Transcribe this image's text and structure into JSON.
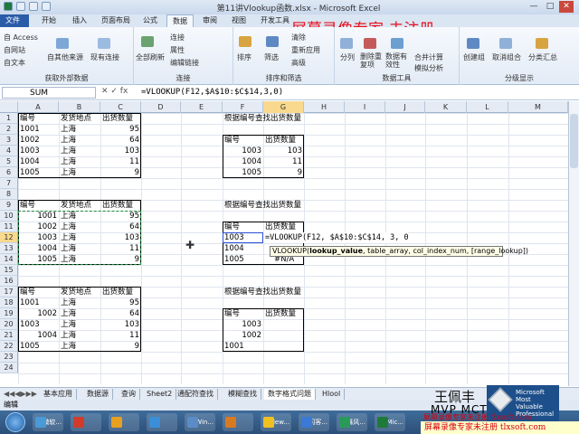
{
  "titlebar": {
    "title": "第11讲Vlookup函数.xlsx - Microsoft Excel",
    "min": "—",
    "max": "□",
    "close": "✕"
  },
  "tabs": [
    "文件",
    "开始",
    "插入",
    "页面布局",
    "公式",
    "数据",
    "审阅",
    "视图",
    "开发工具"
  ],
  "active_tab": "数据",
  "watermark_top": "屏幕录像专家 未注册",
  "ribbon": {
    "get_external": {
      "items": [
        "自 Access",
        "自网站",
        "自文本",
        "自其他来源",
        "现有连接"
      ],
      "label": "获取外部数据"
    },
    "connections": {
      "items": [
        "全部刷新",
        "连接",
        "属性",
        "编辑链接"
      ],
      "label": "连接"
    },
    "sort_filter": {
      "items": [
        "排序",
        "筛选",
        "清除",
        "重新应用",
        "高级"
      ],
      "label": "排序和筛选"
    },
    "data_tools": {
      "items": [
        "分列",
        "删除重复项",
        "数据有效性",
        "合并计算",
        "模拟分析"
      ],
      "label": "数据工具"
    },
    "outline": {
      "items": [
        "创建组",
        "取消组合",
        "分类汇总"
      ],
      "label": "分级显示"
    }
  },
  "formula_bar": {
    "name_box": "SUM",
    "fx": "✕ ✓ fx",
    "formula": "=VLOOKUP(F12,$A$10:$C$14,3,0)"
  },
  "columns": [
    "A",
    "B",
    "C",
    "D",
    "E",
    "F",
    "G",
    "H",
    "I",
    "J",
    "K",
    "L",
    "M"
  ],
  "rows": [
    "1",
    "2",
    "3",
    "4",
    "5",
    "6",
    "7",
    "8",
    "9",
    "10",
    "11",
    "12",
    "13",
    "14",
    "15",
    "16",
    "17",
    "18",
    "19",
    "20",
    "21",
    "22",
    "23",
    "24"
  ],
  "table1": {
    "headers": [
      "编号",
      "发货地点",
      "出货数量"
    ],
    "rows": [
      [
        "1001",
        "上海",
        "95"
      ],
      [
        "1002",
        "上海",
        "64"
      ],
      [
        "1003",
        "上海",
        "103"
      ],
      [
        "1004",
        "上海",
        "11"
      ],
      [
        "1005",
        "上海",
        "9"
      ]
    ]
  },
  "table2": {
    "headers": [
      "编号",
      "发货地点",
      "出货数量"
    ],
    "rows": [
      [
        "1001",
        "上海",
        "95"
      ],
      [
        "1002",
        "上海",
        "64"
      ],
      [
        "1003",
        "上海",
        "103"
      ],
      [
        "1004",
        "上海",
        "11"
      ],
      [
        "1005",
        "上海",
        "9"
      ]
    ]
  },
  "table3": {
    "headers": [
      "编号",
      "发货地点",
      "出货数量"
    ],
    "rows": [
      [
        "1001",
        "上海",
        "95"
      ],
      [
        "1002",
        "上海",
        "64"
      ],
      [
        "1003",
        "上海",
        "103"
      ],
      [
        "1004",
        "上海",
        "11"
      ],
      [
        "1005",
        "上海",
        "9"
      ]
    ]
  },
  "lookup1": {
    "title": "根据编号查找出货数量",
    "headers": [
      "编号",
      "出货数量"
    ],
    "rows": [
      [
        "1003",
        "103"
      ],
      [
        "1004",
        "11"
      ],
      [
        "1005",
        "9"
      ]
    ]
  },
  "lookup2": {
    "title": "根据编号查找出货数量",
    "headers": [
      "编号",
      "出货数量"
    ],
    "rows": [
      [
        "1003",
        "=VLOOKUP(F12, $A$10:$C$14, 3, 0)"
      ],
      [
        "1004",
        ""
      ],
      [
        "1005",
        "#N/A"
      ]
    ]
  },
  "lookup3": {
    "title": "根据编号查找出货数量",
    "headers": [
      "编号",
      "出货数量"
    ],
    "rows": [
      [
        "1003",
        ""
      ],
      [
        "1002",
        ""
      ],
      [
        "1001",
        ""
      ]
    ]
  },
  "tooltip": {
    "fn": "VLOOKUP(",
    "bold_arg": "lookup_value",
    "rest": ", table_array, col_index_num, [range_lookup])"
  },
  "sheet_tabs": [
    "基本应用",
    "数据源",
    "查询",
    "Sheet2",
    "通配符查找",
    "模糊查找",
    "数字格式问题",
    "Hlool"
  ],
  "active_sheet": "数字格式问题",
  "status": "编辑",
  "author": "王佩丰",
  "mvp_text": "MVP MCT",
  "mvp_logo": "Microsoft Most Valuable Professional",
  "watermark_bottom": "屏幕录像专家未注册 tlxsoft.com",
  "watermark_bottom2": "屏幕录像专家未注册 tlxsoft.com",
  "taskbar": [
    "微软...",
    "",
    "",
    "",
    "Win...",
    "",
    "New...",
    "闪客...",
    "暴风...",
    "Mic..."
  ],
  "colors": {
    "file_tab": "#2a5ca8",
    "selected_header": "#f8d98e",
    "watermark": "#e8101e"
  }
}
